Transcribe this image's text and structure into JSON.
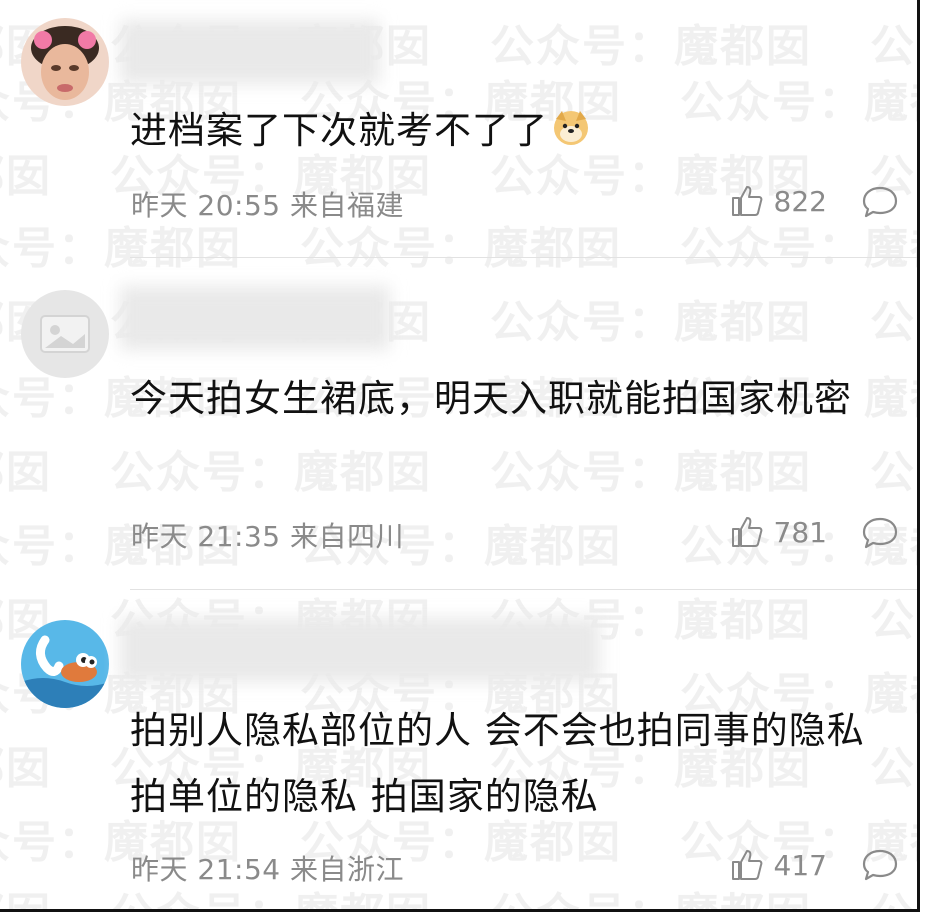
{
  "colors": {
    "text": "#111111",
    "meta": "#8a8a8a",
    "divider": "#e2e2e2",
    "background": "#ffffff"
  },
  "watermark": {
    "text": "公众号：魔都囡"
  },
  "comments": [
    {
      "text": "进档案了下次就考不了了",
      "emoji": "doge-emoji-icon",
      "time": "昨天 20:55 来自福建",
      "likes": "822"
    },
    {
      "text": "今天拍女生裙底，明天入职就能拍国家机密",
      "time": "昨天 21:35 来自四川",
      "likes": "781"
    },
    {
      "text": "拍别人隐私部位的人 会不会也拍同事的隐私 拍单位的隐私 拍国家的隐私",
      "time": "昨天 21:54 来自浙江",
      "likes": "417"
    }
  ]
}
